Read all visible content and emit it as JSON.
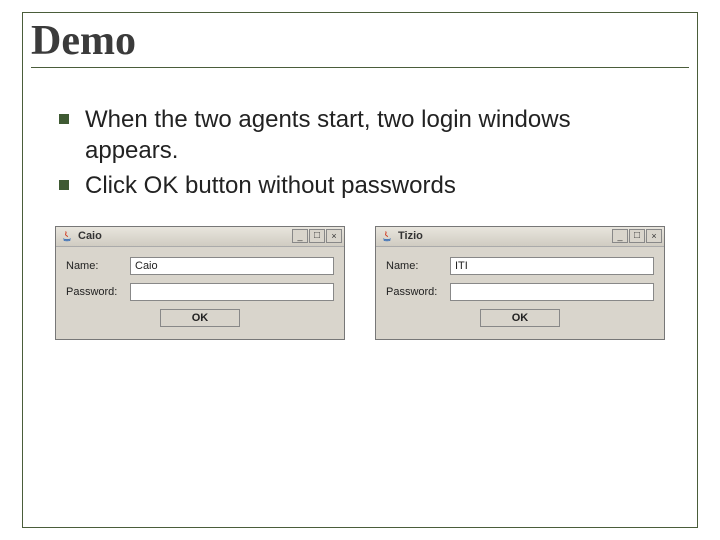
{
  "title": "Demo",
  "bullets": [
    "When the two agents start, two login windows appears.",
    "Click OK button without passwords"
  ],
  "windows": [
    {
      "title": "Caio",
      "nameLabel": "Name:",
      "nameValue": "Caio",
      "passwordLabel": "Password:",
      "passwordValue": "",
      "okLabel": "OK"
    },
    {
      "title": "Tizio",
      "nameLabel": "Name:",
      "nameValue": "ITI",
      "passwordLabel": "Password:",
      "passwordValue": "",
      "okLabel": "OK"
    }
  ]
}
